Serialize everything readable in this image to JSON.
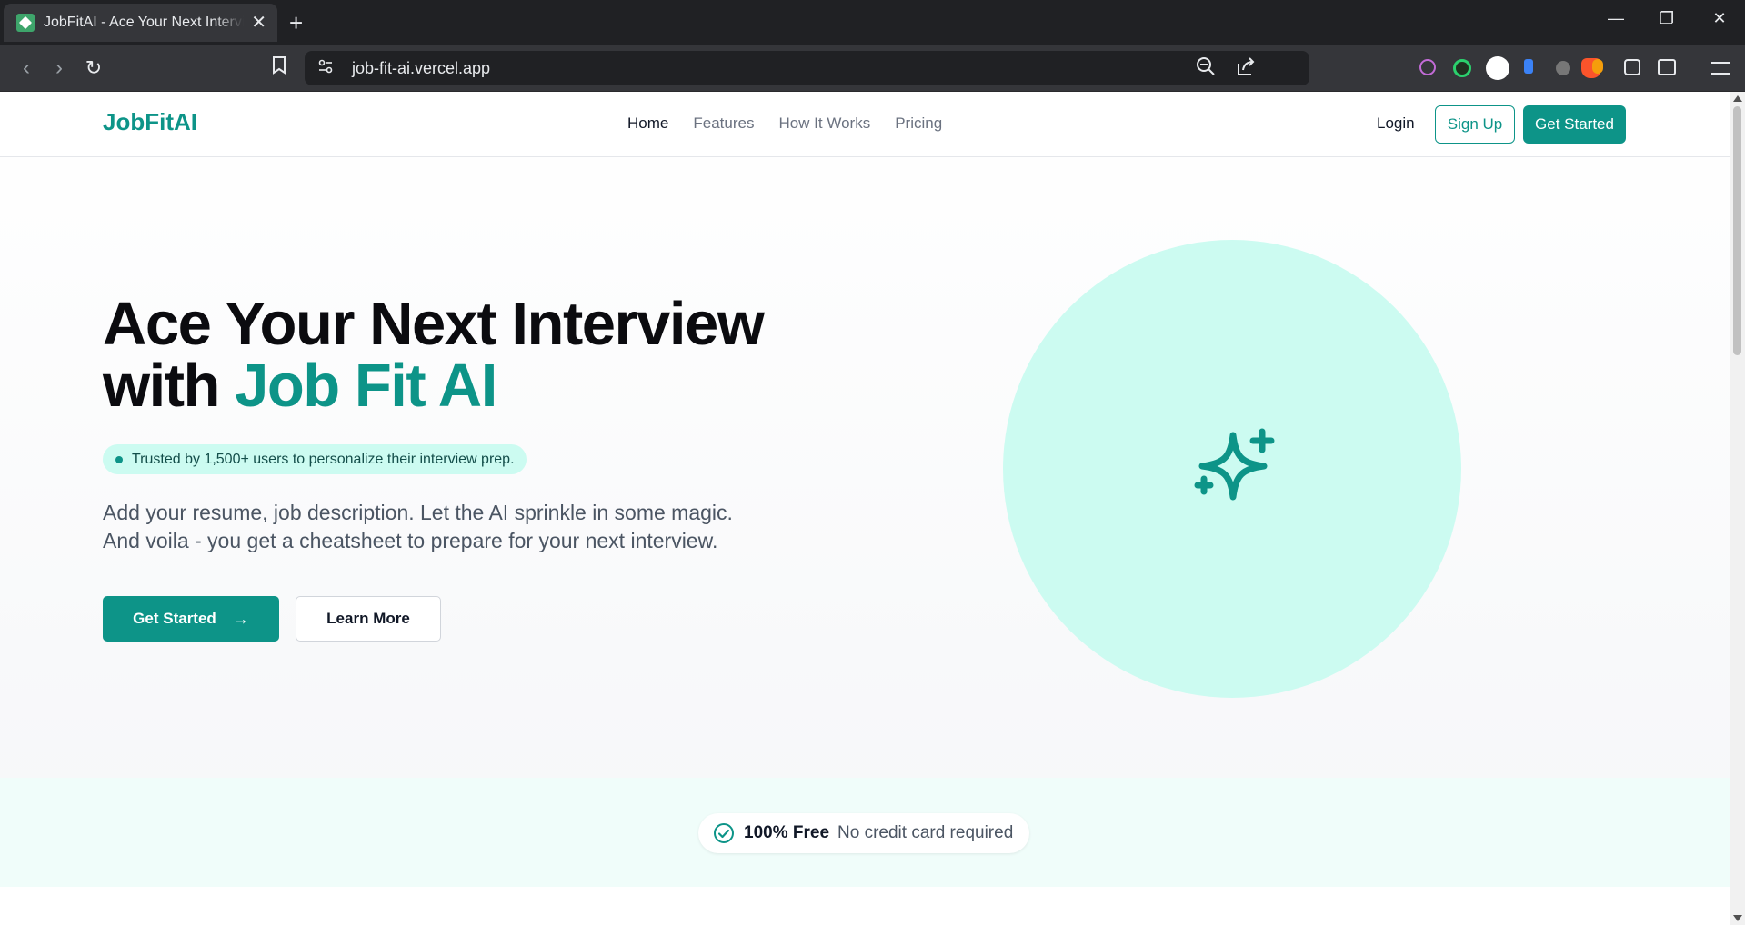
{
  "browser": {
    "tab_title": "JobFitAI - Ace Your Next Interview",
    "tab_close": "✕",
    "new_tab": "+",
    "url": "job-fit-ai.vercel.app",
    "window_controls": {
      "minimize": "—",
      "restore": "❐",
      "close": "✕"
    },
    "nav": {
      "back": "‹",
      "forward": "›",
      "reload": "↻",
      "bookmark": "⌑"
    }
  },
  "site": {
    "logo": "JobFitAI",
    "menu": [
      {
        "label": "Home",
        "active": true
      },
      {
        "label": "Features"
      },
      {
        "label": "How It Works"
      },
      {
        "label": "Pricing"
      }
    ],
    "login": "Login",
    "signup": "Sign Up",
    "get_started_top": "Get Started"
  },
  "hero": {
    "title_line1": "Ace Your Next Interview",
    "title_line2_prefix": "with ",
    "title_line2_accent": "Job Fit AI",
    "badge": "Trusted by 1,500+ users to personalize their interview prep.",
    "lead_line1": "Add your resume, job description. Let the AI sprinkle in some magic.",
    "lead_line2": "And voila - you get a cheatsheet to prepare for your next interview.",
    "cta_primary": "Get Started",
    "cta_primary_arrow": "→",
    "cta_secondary": "Learn More",
    "illustration_icon": "sparkles-icon"
  },
  "strip": {
    "free": "100% Free",
    "note": "No credit card required"
  },
  "colors": {
    "accent": "#0d9488",
    "accent_light": "#ccfbf1",
    "text_dark": "#0b0b0f",
    "text_muted": "#4b5563"
  }
}
